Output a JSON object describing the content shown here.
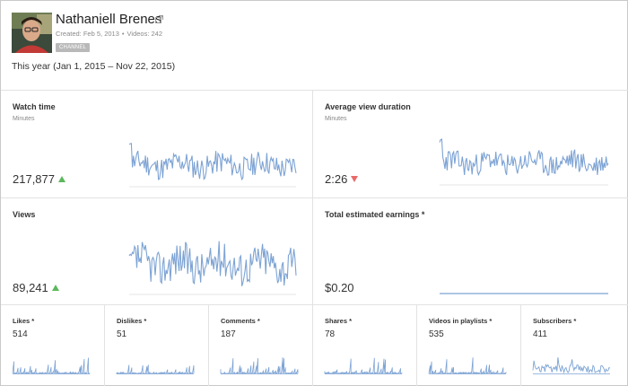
{
  "channel": {
    "name": "Nathaniell Brenes",
    "created": "Created: Feb 5, 2013",
    "videos": "Videos: 242",
    "badge": "CHANNEL",
    "date_range": "This year (Jan 1, 2015 – Nov 22, 2015)"
  },
  "colors": {
    "spark_line": "#7da3d4",
    "trend_up": "#5cb85c",
    "trend_down": "#e86a6a",
    "badge_bg": "#b9b9b9"
  },
  "metrics": {
    "watch_time": {
      "title": "Watch time",
      "unit": "Minutes",
      "value": "217,877",
      "trend": "up"
    },
    "avg_view_duration": {
      "title": "Average view duration",
      "unit": "Minutes",
      "value": "2:26",
      "trend": "down"
    },
    "views": {
      "title": "Views",
      "value": "89,241",
      "trend": "up"
    },
    "earnings": {
      "title": "Total estimated earnings *",
      "value": "$0.20"
    },
    "likes": {
      "title": "Likes *",
      "value": "514"
    },
    "dislikes": {
      "title": "Dislikes *",
      "value": "51"
    },
    "comments": {
      "title": "Comments *",
      "value": "187"
    },
    "shares": {
      "title": "Shares *",
      "value": "78"
    },
    "playlists": {
      "title": "Videos in playlists *",
      "value": "535"
    },
    "subscribers": {
      "title": "Subscribers *",
      "value": "411"
    }
  }
}
